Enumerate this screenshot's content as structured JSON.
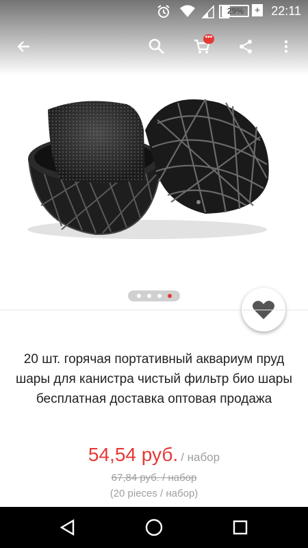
{
  "status_bar": {
    "time": "22:11",
    "battery_text": "29%",
    "battery_level": 0.29,
    "charging_symbol": "+"
  },
  "toolbar": {
    "back_icon": "arrow-left-icon",
    "search_icon": "search-icon",
    "cart_icon": "cart-icon",
    "cart_badge": "•••",
    "share_icon": "share-icon",
    "more_icon": "more-vert-icon"
  },
  "gallery": {
    "image": "aquarium filter bio ball (black plastic sphere with sponge)",
    "page_count": 4,
    "active_page": 4
  },
  "product": {
    "title": "20 шт. горячая портативный аквариум пруд шары для канистра чистый фильтр био шары бесплатная доставка оптовая продажа",
    "price": "54,54 руб.",
    "price_unit": "/ набор",
    "old_price": "67,84 руб. / набор",
    "pieces": "(20 pieces / набор)"
  },
  "favorite": {
    "icon": "heart-icon"
  },
  "nav_bar": {
    "back": "back-triangle-icon",
    "home": "home-circle-icon",
    "recents": "recents-square-icon"
  },
  "colors": {
    "accent": "#e53935",
    "muted": "#9e9e9e",
    "text": "#212121",
    "navbar": "#000000"
  }
}
